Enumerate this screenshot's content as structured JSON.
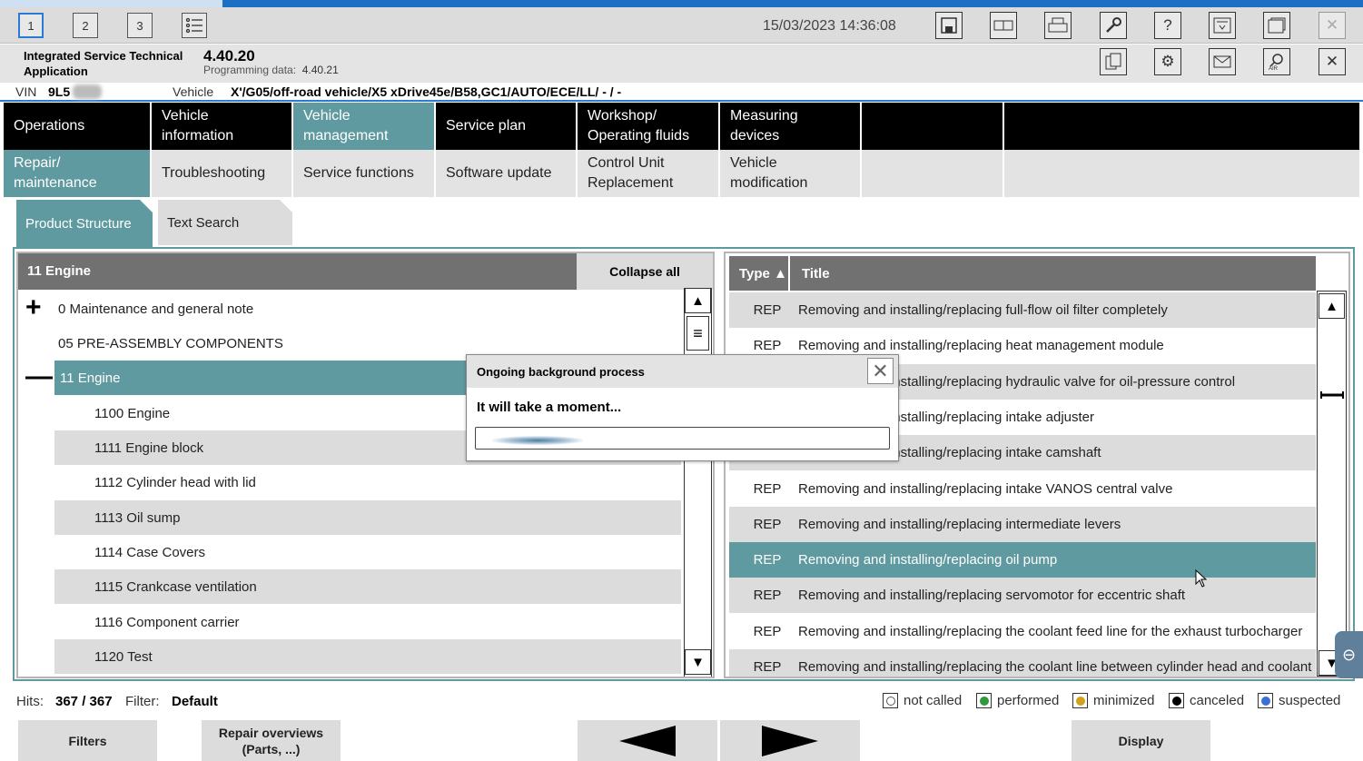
{
  "toolbar": {
    "tabs": [
      "1",
      "2",
      "3"
    ],
    "datetime": "15/03/2023 14:36:08"
  },
  "app": {
    "name": "Integrated Service Technical Application",
    "version": "4.40.20",
    "programming_data_label": "Programming data:",
    "programming_data_value": "4.40.21"
  },
  "vehicle_line": {
    "vin_label": "VIN",
    "vin_value": "9L5",
    "vehicle_label": "Vehicle",
    "vehicle_value": "X'/G05/off-road vehicle/X5 xDrive45e/B58,GC1/AUTO/ECE/LL/ - / -"
  },
  "nav_main": [
    "Operations",
    "Vehicle information",
    "Vehicle management",
    "Service plan",
    "Workshop/ Operating fluids",
    "Measuring devices",
    "",
    ""
  ],
  "nav_sub": [
    "Repair/ maintenance",
    "Troubleshooting",
    "Service functions",
    "Software update",
    "Control Unit Replacement",
    "Vehicle modification",
    "",
    ""
  ],
  "subtabs": [
    "Product Structure",
    "Text Search"
  ],
  "tree": {
    "header": "11 Engine",
    "collapse_label": "Collapse all",
    "rows": [
      {
        "label": "0 Maintenance and general note",
        "glyph": "+"
      },
      {
        "label": "05 PRE-ASSEMBLY COMPONENTS",
        "glyph": ""
      },
      {
        "label": "11 Engine",
        "glyph": "—"
      },
      {
        "label": "1100 Engine",
        "glyph": ""
      },
      {
        "label": "1111 Engine block",
        "glyph": ""
      },
      {
        "label": "1112 Cylinder head with lid",
        "glyph": ""
      },
      {
        "label": "1113 Oil sump",
        "glyph": ""
      },
      {
        "label": "1114 Case Covers",
        "glyph": ""
      },
      {
        "label": "1115 Crankcase ventilation",
        "glyph": ""
      },
      {
        "label": "1116 Component carrier",
        "glyph": ""
      },
      {
        "label": "1120 Test",
        "glyph": ""
      }
    ]
  },
  "results": {
    "col_type": "Type ▲",
    "col_title": "Title",
    "rows": [
      {
        "type": "REP",
        "title": "Removing and installing/replacing full-flow oil filter completely"
      },
      {
        "type": "REP",
        "title": "Removing and installing/replacing heat management module"
      },
      {
        "type": "REP",
        "title": "Removing and installing/replacing hydraulic valve for oil-pressure control"
      },
      {
        "type": "REP",
        "title": "Removing and installing/replacing intake adjuster"
      },
      {
        "type": "REP",
        "title": "Removing and installing/replacing intake camshaft"
      },
      {
        "type": "REP",
        "title": "Removing and installing/replacing intake VANOS central valve"
      },
      {
        "type": "REP",
        "title": "Removing and installing/replacing intermediate levers"
      },
      {
        "type": "REP",
        "title": "Removing and installing/replacing oil pump"
      },
      {
        "type": "REP",
        "title": "Removing and installing/replacing servomotor for eccentric shaft"
      },
      {
        "type": "REP",
        "title": "Removing and installing/replacing the coolant feed line for the exhaust turbocharger"
      },
      {
        "type": "REP",
        "title": "Removing and installing/replacing the coolant line between cylinder head and coolant"
      }
    ]
  },
  "status": {
    "hits_label": "Hits:",
    "hits_value": "367 / 367",
    "filter_label": "Filter:",
    "filter_value": "Default",
    "legend": [
      {
        "label": "not called",
        "color": "#ffffff"
      },
      {
        "label": "performed",
        "color": "#2e9a3a"
      },
      {
        "label": "minimized",
        "color": "#d4a017"
      },
      {
        "label": "canceled",
        "color": "#000000"
      },
      {
        "label": "suspected",
        "color": "#3a6fd8"
      }
    ]
  },
  "buttons": {
    "filters": "Filters",
    "repair_overviews": "Repair overviews (Parts, ...)",
    "display": "Display"
  },
  "modal": {
    "title": "Ongoing background process",
    "message": "It will take a moment...",
    "close_icon": "close-icon"
  },
  "colors": {
    "accent": "#5f9aa0",
    "header_gray": "#717171",
    "nav_black": "#000000",
    "top_blue": "#1d6fc4"
  }
}
